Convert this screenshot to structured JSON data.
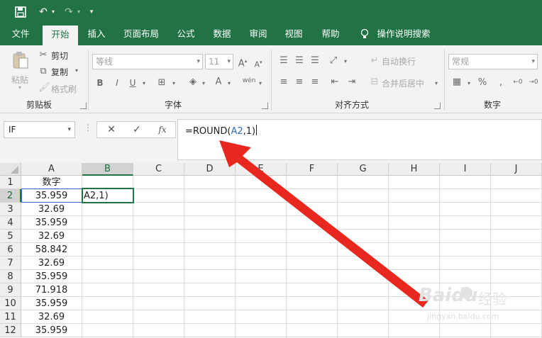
{
  "qat": {
    "save_icon": "save-icon",
    "undo_icon": "undo-icon",
    "redo_icon": "redo-icon",
    "customize_icon": "customize-qat-icon"
  },
  "tabs": [
    "文件",
    "开始",
    "插入",
    "页面布局",
    "公式",
    "数据",
    "审阅",
    "视图",
    "帮助"
  ],
  "tell_me": "操作说明搜索",
  "ribbon": {
    "clipboard": {
      "label": "剪贴板",
      "paste": "粘贴",
      "cut": "剪切",
      "copy": "复制",
      "format_painter": "格式刷"
    },
    "font": {
      "label": "字体",
      "font_name": "等线",
      "font_size": "11",
      "bold": "B",
      "italic": "I",
      "underline": "U",
      "phonetic": "wén"
    },
    "alignment": {
      "label": "对齐方式",
      "wrap_text": "自动换行",
      "merge_center": "合并后居中"
    },
    "number": {
      "label": "数字",
      "format": "常规",
      "percent": "%"
    }
  },
  "formula_bar": {
    "name_box": "IF",
    "cancel_icon": "✕",
    "enter_icon": "✓",
    "fx_label": "fx",
    "formula_prefix": "=ROUND(",
    "formula_ref": "A2",
    "formula_suffix": ",1)"
  },
  "sheet": {
    "columns": [
      "A",
      "B",
      "C",
      "D",
      "E",
      "F",
      "G",
      "H",
      "I",
      "J"
    ],
    "rows": [
      "1",
      "2",
      "3",
      "4",
      "5",
      "6",
      "7",
      "8",
      "9",
      "10",
      "11",
      "12"
    ],
    "header_cell": "数字",
    "values": [
      "35.959",
      "32.69",
      "35.959",
      "32.69",
      "58.842",
      "32.69",
      "35.959",
      "71.918",
      "35.959",
      "32.69",
      "35.959"
    ],
    "edit_cell_text": "A2,1)"
  },
  "watermark": {
    "brand": "Baidu",
    "suffix": "经验",
    "url": "jingyan.baidu.com"
  },
  "colors": {
    "excel_green": "#217346",
    "ref_blue": "#2f6ec6",
    "arrow_red": "#e8281e"
  }
}
